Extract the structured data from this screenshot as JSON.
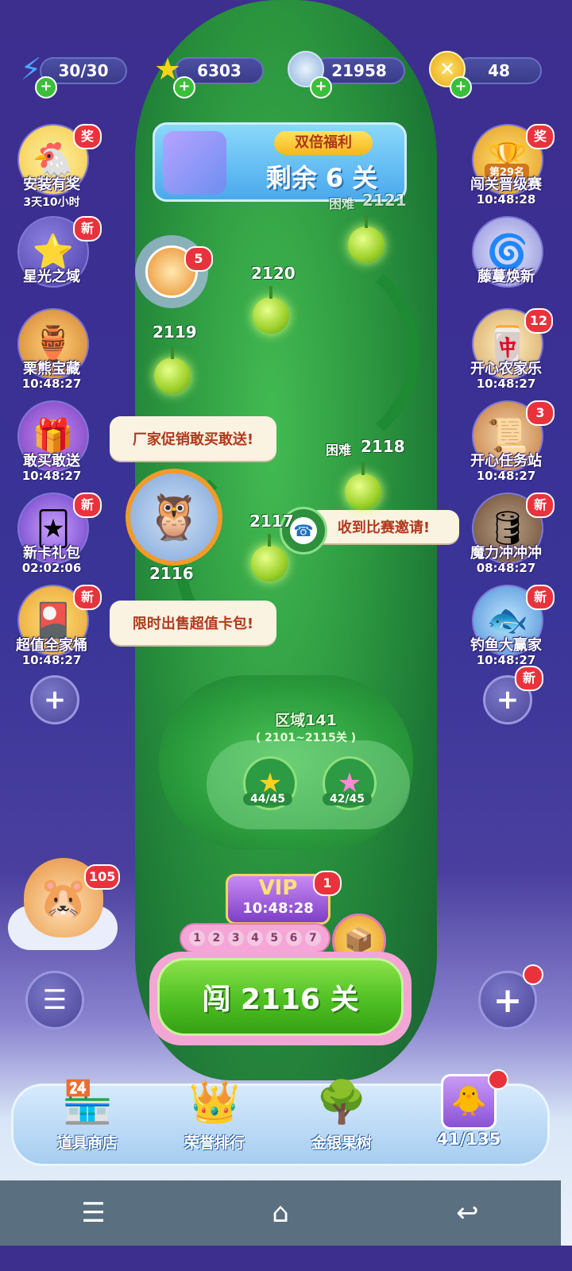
{
  "currency": {
    "energy": {
      "value": "30/30",
      "icon": "lightning-icon"
    },
    "stars": {
      "value": "6303",
      "icon": "star-icon"
    },
    "gems": {
      "value": "21958",
      "icon": "leaf-coin-icon"
    },
    "coins": {
      "value": "48",
      "icon": "gold-coin-icon"
    }
  },
  "banner": {
    "tag": "双倍福利",
    "text": "剩余 6 关"
  },
  "left_items": [
    {
      "label": "安装有奖",
      "time": "3天10小时",
      "badge": "奖"
    },
    {
      "label": "星光之域",
      "time": "",
      "badge": "新"
    },
    {
      "label": "栗熊宝藏",
      "time": "10:48:27",
      "badge": ""
    },
    {
      "label": "敢买敢送",
      "time": "10:48:27",
      "badge": ""
    },
    {
      "label": "新卡礼包",
      "time": "02:02:06",
      "badge": "新"
    },
    {
      "label": "超值全家桶",
      "time": "10:48:27",
      "badge": "新"
    }
  ],
  "right_items": [
    {
      "label": "闯关晋级赛",
      "time": "10:48:28",
      "badge": "奖",
      "rank": "第29名"
    },
    {
      "label": "藤蔓焕新",
      "time": "",
      "badge": ""
    },
    {
      "label": "开心农家乐",
      "time": "10:48:27",
      "badge": "12"
    },
    {
      "label": "开心任务站",
      "time": "10:48:27",
      "badge": "3"
    },
    {
      "label": "魔力冲冲冲",
      "time": "08:48:27",
      "badge": "新"
    },
    {
      "label": "钓鱼大赢家",
      "time": "10:48:27",
      "badge": "新"
    }
  ],
  "right_plus_badge": "新",
  "bubbles": {
    "promo1": "厂家促销敢买敢送!",
    "invite": "收到比赛邀请!",
    "promo2": "限时出售超值卡包!"
  },
  "levels": {
    "l2121": "2121",
    "hard1": "困难",
    "l2120": "2120",
    "l2119": "2119",
    "hard2": "困难",
    "l2118": "2118",
    "l2117": "2117",
    "l2116": "2116",
    "wheel_badge": "5"
  },
  "zone": {
    "title": "区域141",
    "range": "( 2101~2115关 )",
    "stars1": "44/45",
    "stars2": "42/45"
  },
  "pet_badge": "105",
  "vip": {
    "label": "VIP",
    "time": "10:48:28",
    "badge": "1",
    "steps": [
      "1",
      "2",
      "3",
      "4",
      "5",
      "6",
      "7"
    ]
  },
  "play_button": "闯 2116 关",
  "bottom_nav": [
    {
      "label": "道具商店",
      "icon": "shop-icon"
    },
    {
      "label": "荣誉排行",
      "icon": "crown-icon"
    },
    {
      "label": "金银果树",
      "icon": "tree-icon"
    },
    {
      "label": "41/135",
      "icon": "card-album-icon"
    }
  ],
  "colors": {
    "play_green": "#4fc024",
    "badge_red": "#e8333d",
    "banner_blue": "#5fc3ef"
  }
}
